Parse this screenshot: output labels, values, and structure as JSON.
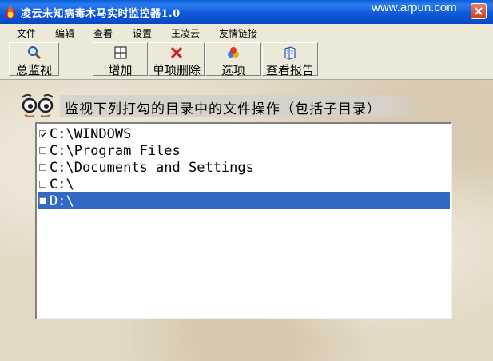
{
  "window": {
    "title": "凌云未知病毒木马实时监控器1.0",
    "watermark": "www.arpun.com"
  },
  "menu": [
    "文件",
    "编辑",
    "查看",
    "设置",
    "王凌云",
    "友情链接"
  ],
  "toolbar": {
    "buttons": [
      {
        "label": "总监视",
        "icon": "magnifier-icon"
      },
      {
        "label": "增加",
        "icon": "grid-icon"
      },
      {
        "label": "单项删除",
        "icon": "red-x-icon"
      },
      {
        "label": "选项",
        "icon": "options-icon"
      },
      {
        "label": "查看报告",
        "icon": "report-icon"
      }
    ]
  },
  "banner": {
    "text": "监视下列打勾的目录中的文件操作（包括子目录）",
    "icon": "eyes-icon"
  },
  "directories": [
    {
      "path": "C:\\WINDOWS",
      "checked": true,
      "selected": false
    },
    {
      "path": "C:\\Program Files",
      "checked": false,
      "selected": false
    },
    {
      "path": "C:\\Documents and Settings",
      "checked": false,
      "selected": false
    },
    {
      "path": "C:\\",
      "checked": false,
      "selected": false
    },
    {
      "path": "D:\\",
      "checked": false,
      "selected": true
    }
  ],
  "colors": {
    "titlebar": "#0a5fd6",
    "selection": "#316ac5",
    "background": "#e2d8c3"
  }
}
